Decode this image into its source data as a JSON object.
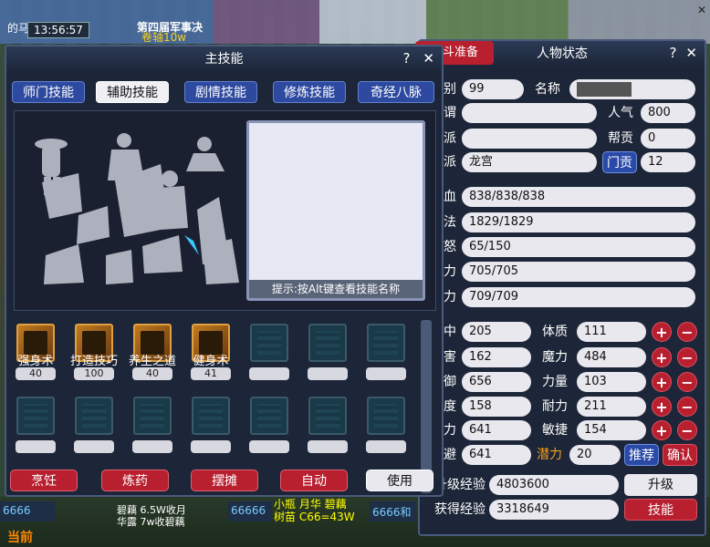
{
  "top": {
    "time": "13:56:57",
    "left_text": "的马",
    "banner_text": "第四届军事决",
    "banner_sub": "卷轴10w"
  },
  "bottom": {
    "badge1": "6666",
    "current_label": "当前",
    "badge2": "66666",
    "badge3": "6666和",
    "chat1": "小瓶 月华 碧藕",
    "chat2": "树苗 C66=43W",
    "chat3": "碧藕 6.5W收月",
    "chat4": "华露 7w收碧藕"
  },
  "skill_window": {
    "title": "主技能",
    "help": "?",
    "close": "✕",
    "tabs": [
      "师门技能",
      "辅助技能",
      "剧情技能",
      "修炼技能",
      "奇经八脉"
    ],
    "active_tab": 1,
    "hint": "提示:按Alt键查看技能名称",
    "skills": [
      {
        "name": "强身术",
        "level": "40"
      },
      {
        "name": "打造技巧",
        "level": "100"
      },
      {
        "name": "养生之道",
        "level": "40"
      },
      {
        "name": "健身术",
        "level": "41"
      }
    ],
    "actions": [
      "烹饪",
      "炼药",
      "摆摊",
      "自动",
      "使用"
    ]
  },
  "status_window": {
    "title": "人物状态",
    "help": "?",
    "close": "✕",
    "battle_tab": "战斗准备",
    "labels": {
      "level": "级别",
      "name": "名称",
      "title_lbl": "称谓",
      "popularity": "人气",
      "gang": "帮派",
      "contribution": "帮贡",
      "sect": "门派",
      "sect_contribution": "门贡",
      "hp": "气血",
      "mp": "魔法",
      "anger": "愤怒",
      "vitality": "活力",
      "stamina": "体力",
      "hit": "命中",
      "strength": "体质",
      "damage": "伤害",
      "magic": "魔力",
      "defense": "防御",
      "power": "力量",
      "speed": "速度",
      "endurance": "耐力",
      "spirit_def": "灵力",
      "agility": "敏捷",
      "dodge": "躲避",
      "potential": "潜力",
      "recommend": "推荐",
      "confirm": "确认",
      "upgrade_exp": "升级经验",
      "upgrade": "升级",
      "gain_exp": "获得经验",
      "skills": "技能"
    },
    "values": {
      "level": "99",
      "popularity": "800",
      "contribution": "0",
      "sect": "龙宫",
      "sect_contribution": "12",
      "hp": "838/838/838",
      "mp": "1829/1829",
      "anger": "65/150",
      "vitality": "705/705",
      "stamina": "709/709",
      "hit": "205",
      "strength": "111",
      "damage": "162",
      "magic": "484",
      "defense": "656",
      "power": "103",
      "speed": "158",
      "endurance": "211",
      "spirit_def": "641",
      "agility": "154",
      "dodge": "641",
      "potential": "20",
      "upgrade_exp": "4803600",
      "gain_exp": "3318649"
    }
  }
}
